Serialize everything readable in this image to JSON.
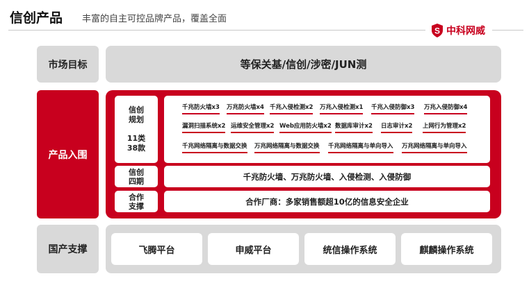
{
  "header": {
    "title": "信创产品",
    "subtitle": "丰富的自主可控品牌产品，覆盖全面",
    "logo_text": "中科网威",
    "logo_icon": "shield-s-icon",
    "accent_color": "#c8001e"
  },
  "market": {
    "label": "市场目标",
    "content": "等保关基/信创/涉密/JUN测"
  },
  "products": {
    "label": "产品入围",
    "planning": {
      "label_line1": "信创",
      "label_line2": "规划",
      "count_line1": "11类",
      "count_line2": "38款",
      "items": [
        "千兆防火墙x3",
        "万兆防火墙x4",
        "千兆入侵检测x2",
        "万兆入侵检测x1",
        "千兆入侵防御x3",
        "万兆入侵防御x4",
        "漏洞扫描系统x2",
        "运维安全管理x2",
        "Web应用防火墙x2",
        "数据库审计x2",
        "日志审计x2",
        "上网行为管理x2",
        "千兆网络隔离与数据交换",
        "万兆网络隔离与数据交换",
        "千兆网络隔离与单向导入",
        "万兆网络隔离与单向导入"
      ]
    },
    "phase4": {
      "label_line1": "信创",
      "label_line2": "四期",
      "content": "千兆防火墙、万兆防火墙、入侵检测、入侵防御"
    },
    "partner": {
      "label_line1": "合作",
      "label_line2": "支撑",
      "content": "合作厂商：多家销售额超10亿的信息安全企业"
    }
  },
  "support": {
    "label": "国产支撑",
    "platforms": [
      "飞腾平台",
      "申威平台",
      "统信操作系统",
      "麒麟操作系统"
    ]
  }
}
